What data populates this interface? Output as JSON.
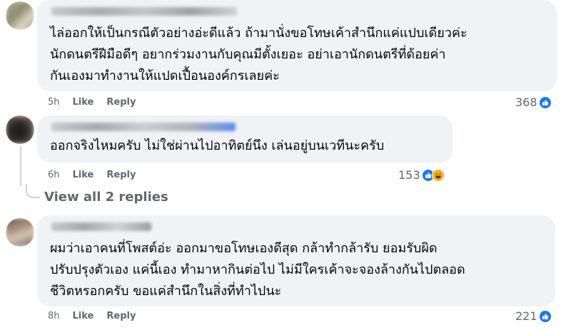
{
  "comments": [
    {
      "lines": [
        "ไล่ออกให้เป็นกรณีตัวอย่างอ่ะดีแล้ว ถ้ามานั่งขอโทษเค้าสำนึกแค่แปบเดียวค่ะ",
        "นักดนตรีฝีมือดีๆ อยากร่วมงานกับคุณมีตั้งเยอะ อย่าเอานักดนตรีที่ด้อยค่า",
        "กันเองมาทำงานให้แปดเปื้อนองค์กรเลยค่ะ"
      ],
      "time": "5h",
      "like_label": "Like",
      "reply_label": "Reply",
      "reaction_count": "368",
      "reactions": [
        "like-icon"
      ]
    },
    {
      "lines": [
        "ออกจริงไหมครับ ไม่ใช่ผ่านไปอาทิตย์นึง เล่นอยู่บนเวทีนะครับ"
      ],
      "time": "6h",
      "like_label": "Like",
      "reply_label": "Reply",
      "reaction_count": "153",
      "reactions": [
        "like-icon",
        "haha-icon"
      ]
    },
    {
      "lines": [
        "ผมว่าเอาคนที่โพสต์อ่ะ ออกมาขอโทษเองดีสุด กล้าทำกล้ารับ ยอมรับผิด",
        "ปรับปรุงตัวเอง แค่นี้เอง ทำมาหากินต่อไป ไม่มีใครเค้าจะจองล้างกันไปตลอด",
        "ชีวิตหรอกครับ ขอแค่สำนึกในสิ่งที่ทำไปนะ"
      ],
      "time": "8h",
      "like_label": "Like",
      "reply_label": "Reply",
      "reaction_count": "221",
      "reactions": [
        "like-icon"
      ]
    }
  ],
  "view_replies_label": "View all 2 replies",
  "colors": {
    "bubble": "#f0f2f5",
    "meta_text": "#65676b",
    "like_blue": "#1877f2",
    "haha_yellow": "#f7b125"
  }
}
